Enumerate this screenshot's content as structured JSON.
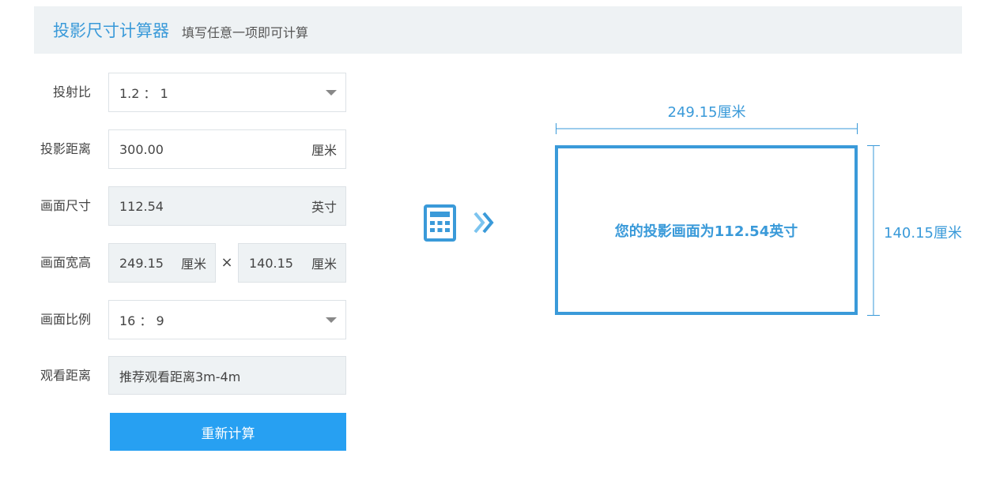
{
  "header": {
    "title": "投影尺寸计算器",
    "subtitle": "填写任意一项即可计算"
  },
  "form": {
    "throw_ratio": {
      "label": "投射比",
      "value": "1.2 ： 1"
    },
    "distance": {
      "label": "投影距离",
      "value": "300.00",
      "unit": "厘米"
    },
    "screen_size": {
      "label": "画面尺寸",
      "value": "112.54",
      "unit": "英寸"
    },
    "screen_dims": {
      "label": "画面宽高",
      "width": "249.15",
      "width_unit": "厘米",
      "times": "×",
      "height": "140.15",
      "height_unit": "厘米"
    },
    "aspect_ratio": {
      "label": "画面比例",
      "value": "16 ： 9"
    },
    "viewing_distance": {
      "label": "观看距离",
      "value": "推荐观看距离3m-4m"
    },
    "recalc_label": "重新计算"
  },
  "result": {
    "width_text": "249.15厘米",
    "height_text": "140.15厘米",
    "message": "您的投影画面为112.54英寸"
  },
  "icons": {
    "calculator": "calculator-icon",
    "arrow": "double-chevron-right-icon",
    "dropdown": "caret-down-icon"
  },
  "colors": {
    "accent": "#3a9ad9",
    "button": "#27a0f2",
    "header_bg": "#eef2f4",
    "readonly_bg": "#eef2f4"
  }
}
